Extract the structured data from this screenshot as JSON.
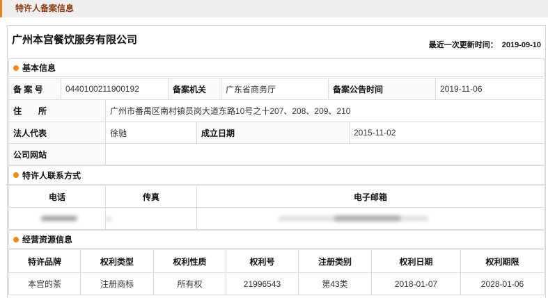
{
  "header": {
    "title": "特许人备案信息"
  },
  "company": {
    "name": "广州本宫餐饮服务有限公司",
    "update_label": "最近一次更新时间：",
    "update_date": "2019-09-10"
  },
  "sections": {
    "basic": "基本信息",
    "contact": "特许人联系方式",
    "resources": "经营资源信息"
  },
  "basic_info": {
    "record_no_label": "备 案 号",
    "record_no": "0440100211900192",
    "authority_label": "备案机关",
    "authority": "广东省商务厅",
    "announce_label": "备案公告时间",
    "announce_date": "2019-11-06",
    "address_label": "住　　所",
    "address": "广州市番禺区南村镇员岗大道东路10号之十207、208、209、210",
    "legal_rep_label": "法人代表",
    "legal_rep": "徐驰",
    "founded_label": "成立日期",
    "founded_date": "2015-11-02",
    "website_label": "公司网站"
  },
  "contact": {
    "headers": [
      "电话",
      "传真",
      "电子邮箱"
    ]
  },
  "resources": {
    "headers": [
      "特许品牌",
      "权利类型",
      "权利性质",
      "权利号",
      "注册类别",
      "权利日期",
      "权利期限"
    ],
    "rows": [
      [
        "本宫的茶",
        "注册商标",
        "所有权",
        "21996543",
        "第43类",
        "2018-01-07",
        "2028-01-06"
      ]
    ]
  },
  "colors": {
    "accent": "#ef8a17",
    "header_text": "#8a3a12",
    "header_bg": "#efefef",
    "border": "#dcdcdc"
  }
}
